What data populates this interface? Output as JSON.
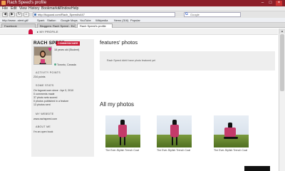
{
  "browser": {
    "window_title": "Rach Speed's profile",
    "menu": [
      "File",
      "Edit",
      "View",
      "History",
      "Bookmarks",
      "Window",
      "Help"
    ],
    "url": "http://fuguost.com/Rach_Speed/s447",
    "search_placeholder": "Google",
    "bookmarks": [
      "http://www...sient.gif/",
      "Spark",
      "Station",
      "Google Maps",
      "YouTube",
      "Wikipedia",
      "News (316)",
      "Popular"
    ],
    "tabs": [
      "Facebook",
      "Bloggers: Rach Speed - Ed...",
      "Rach Speed's profile"
    ]
  },
  "site": {
    "breadcrumb": "MY PROFILE"
  },
  "profile": {
    "name": "RACH SPEED",
    "role": "COMMISSIONER",
    "tagline": "18 years old (Student)",
    "location": "Toronto, Canada",
    "activity_title": "ACTIVITY POINTS",
    "activity_points": "234 points",
    "stats_title": "SOME STATS",
    "stats": [
      "On fuguost.com since : Apr 3, 2010",
      "0 comments made",
      "37 photo sets scored",
      "0 photos published in a feature",
      "13 photos sent"
    ],
    "website_title": "MY WEBSITE",
    "website": "www.rachspeed.com",
    "about_title": "ABOUT ME",
    "about": "I'm an open book"
  },
  "features": {
    "title": "features' photos",
    "empty_message": "Rach Speed didn't have photo featured yet"
  },
  "all_photos": {
    "title": "All my photos",
    "items": [
      {
        "caption": "The Ever-Stylish Trench Coat"
      },
      {
        "caption": "The Ever-Stylish Trench Coat"
      },
      {
        "caption": "The Ever-Stylish Trench Coat"
      }
    ]
  }
}
